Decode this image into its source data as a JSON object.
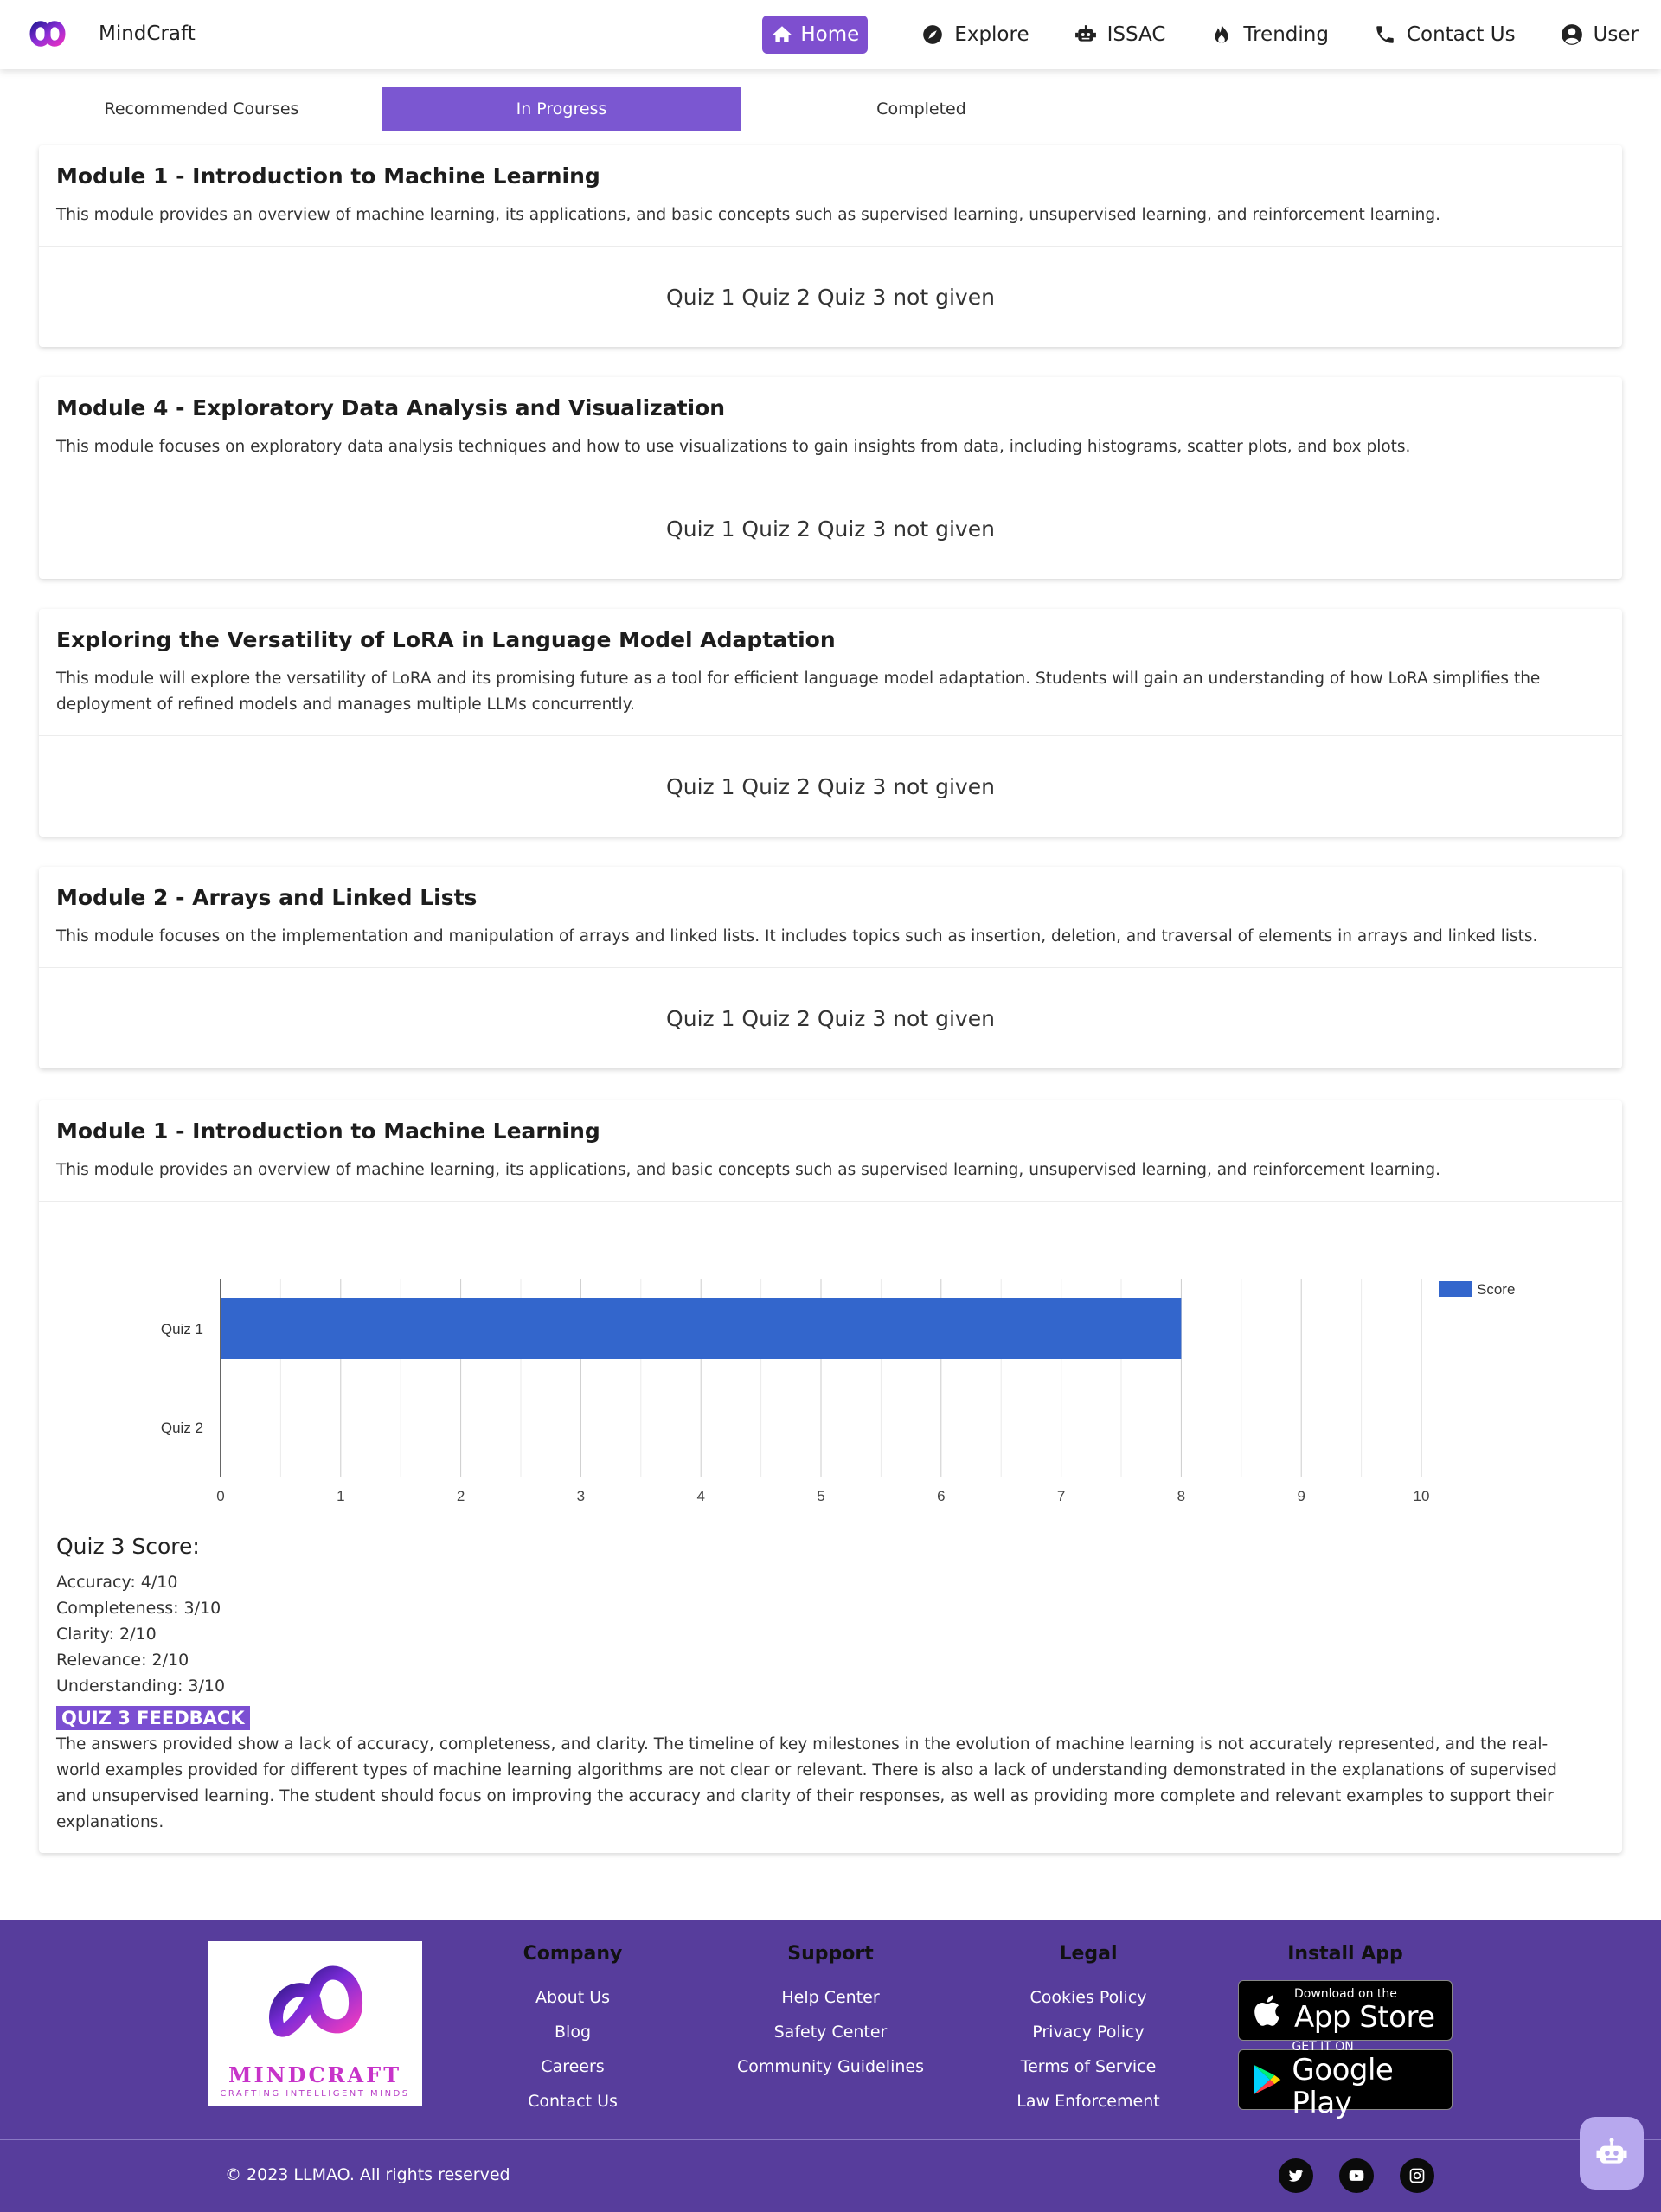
{
  "brand": {
    "name": "MindCraft"
  },
  "nav": {
    "items": [
      {
        "label": "Home",
        "icon": "home-icon",
        "active": true
      },
      {
        "label": "Explore",
        "icon": "compass-icon"
      },
      {
        "label": "ISSAC",
        "icon": "robot-icon"
      },
      {
        "label": "Trending",
        "icon": "fire-icon"
      },
      {
        "label": "Contact Us",
        "icon": "phone-icon"
      },
      {
        "label": "User",
        "icon": "user-circle-icon"
      }
    ]
  },
  "tabs": [
    {
      "label": "Recommended Courses"
    },
    {
      "label": "In Progress",
      "active": true
    },
    {
      "label": "Completed"
    }
  ],
  "modules": [
    {
      "title": "Module 1 - Introduction to Machine Learning",
      "description": "This module provides an overview of machine learning, its applications, and basic concepts such as supervised learning, unsupervised learning, and reinforcement learning.",
      "quiz_status": "Quiz 1 Quiz 2 Quiz 3 not given"
    },
    {
      "title": "Module 4 - Exploratory Data Analysis and Visualization",
      "description": "This module focuses on exploratory data analysis techniques and how to use visualizations to gain insights from data, including histograms, scatter plots, and box plots.",
      "quiz_status": "Quiz 1 Quiz 2 Quiz 3 not given"
    },
    {
      "title": "Exploring the Versatility of LoRA in Language Model Adaptation",
      "description": "This module will explore the versatility of LoRA and its promising future as a tool for efficient language model adaptation. Students will gain an understanding of how LoRA simplifies the deployment of refined models and manages multiple LLMs concurrently.",
      "quiz_status": "Quiz 1 Quiz 2 Quiz 3 not given"
    },
    {
      "title": "Module 2 - Arrays and Linked Lists",
      "description": "This module focuses on the implementation and manipulation of arrays and linked lists. It includes topics such as insertion, deletion, and traversal of elements in arrays and linked lists.",
      "quiz_status": "Quiz 1 Quiz 2 Quiz 3 not given"
    },
    {
      "title": "Module 1 - Introduction to Machine Learning",
      "description": "This module provides an overview of machine learning, its applications, and basic concepts such as supervised learning, unsupervised learning, and reinforcement learning."
    }
  ],
  "chart_data": {
    "type": "bar",
    "orientation": "horizontal",
    "categories": [
      "Quiz 1",
      "Quiz 2"
    ],
    "series": [
      {
        "name": "Score",
        "values": [
          8,
          0
        ],
        "color": "#3366cc"
      }
    ],
    "xlim": [
      0,
      10
    ],
    "xticks": [
      0,
      1,
      2,
      3,
      4,
      5,
      6,
      7,
      8,
      9,
      10
    ],
    "legend": "top-right",
    "grid": true
  },
  "quiz3": {
    "title": "Quiz 3 Score:",
    "scores": [
      "Accuracy: 4/10",
      "Completeness: 3/10",
      "Clarity: 2/10",
      "Relevance: 2/10",
      "Understanding: 3/10"
    ],
    "feedback_label": "QUIZ 3 FEEDBACK",
    "feedback_text": "The answers provided show a lack of accuracy, completeness, and clarity. The timeline of key milestones in the evolution of machine learning is not accurately represented, and the real-world examples provided for different types of machine learning algorithms are not clear or relevant. There is also a lack of understanding demonstrated in the explanations of supervised and unsupervised learning. The student should focus on improving the accuracy and clarity of their responses, as well as providing more complete and relevant examples to support their explanations."
  },
  "footer": {
    "logo_name": "MINDCRAFT",
    "logo_tagline": "CRAFTING INTELLIGENT MINDS",
    "columns": [
      {
        "title": "Company",
        "links": [
          "About Us",
          "Blog",
          "Careers",
          "Contact Us"
        ]
      },
      {
        "title": "Support",
        "links": [
          "Help Center",
          "Safety Center",
          "Community Guidelines"
        ]
      },
      {
        "title": "Legal",
        "links": [
          "Cookies Policy",
          "Privacy Policy",
          "Terms of Service",
          "Law Enforcement"
        ]
      }
    ],
    "install": {
      "title": "Install App",
      "app_store": {
        "small": "Download on the",
        "big": "App Store"
      },
      "google_play": {
        "small": "GET IT ON",
        "big": "Google Play"
      }
    },
    "copyright": "© 2023 LLMAO. All rights reserved",
    "socials": [
      "twitter-icon",
      "youtube-icon",
      "instagram-icon"
    ]
  },
  "colors": {
    "accent": "#7b57d1",
    "footer_bg": "#573d9c",
    "bar": "#3366cc",
    "chatbot": "#b7a8ee"
  }
}
